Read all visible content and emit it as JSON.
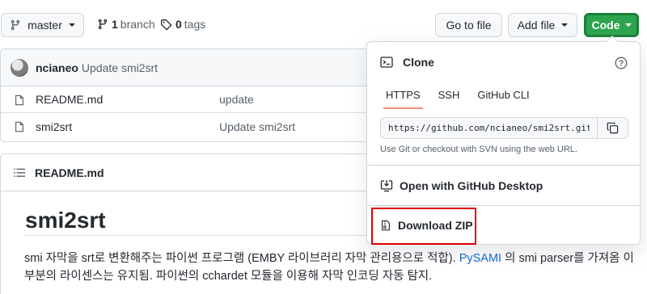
{
  "toolbar": {
    "branch_label": "master",
    "branch_count": "1",
    "branch_word": "branch",
    "tag_count": "0",
    "tag_word": "tags",
    "goto_file_label": "Go to file",
    "add_file_label": "Add file",
    "code_label": "Code"
  },
  "commit": {
    "author": "ncianeo",
    "message": "Update smi2srt"
  },
  "files": [
    {
      "name": "README.md",
      "commit": "update",
      "icon": "file-icon"
    },
    {
      "name": "smi2srt",
      "commit": "Update smi2srt",
      "icon": "file-icon"
    }
  ],
  "readme": {
    "header": "README.md",
    "title": "smi2srt",
    "paragraph_before_link": "smi 자막을 srt로 변환해주는 파이썬 프로그램 (EMBY 라이브러리 자막 관리용으로 적합). ",
    "link_text": "PySAMI",
    "paragraph_after_link": " 의 smi parser를 가져옴 이 부분의 라이센스는 유지됨. 파이썬의 cchardet 모듈을 이용해 자막 인코딩 자동 탐지."
  },
  "clone_menu": {
    "title": "Clone",
    "tabs": [
      {
        "label": "HTTPS",
        "active": true
      },
      {
        "label": "SSH",
        "active": false
      },
      {
        "label": "GitHub CLI",
        "active": false
      }
    ],
    "url": "https://github.com/ncianeo/smi2srt.git",
    "note": "Use Git or checkout with SVN using the web URL.",
    "open_desktop_label": "Open with GitHub Desktop",
    "download_zip_label": "Download ZIP"
  },
  "colors": {
    "code_button": "#2da44e",
    "link": "#0969da",
    "tab_underline": "#fd8c73",
    "highlight_box": "#e00000"
  }
}
